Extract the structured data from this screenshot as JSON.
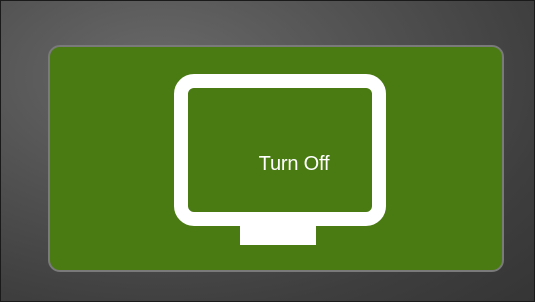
{
  "tile": {
    "label": "Turn Off",
    "icon": "monitor-icon",
    "state_color": "#4a7a12"
  }
}
